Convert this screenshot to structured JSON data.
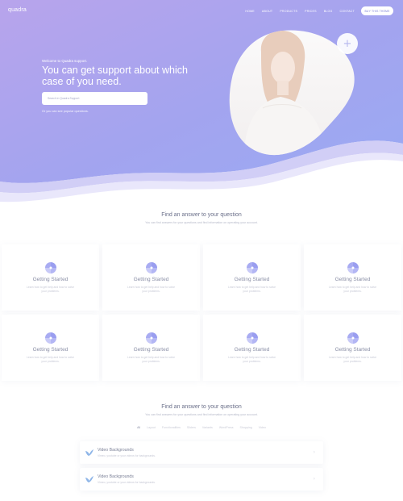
{
  "header": {
    "logo": "quadra",
    "nav": [
      "HOME",
      "ABOUT",
      "PRODUCTS",
      "PRICES",
      "BLOG",
      "CONTACT"
    ],
    "cta": "BUY THIS THEME"
  },
  "hero": {
    "welcome": "Welcome to Quadra support.",
    "title": "You can get support about which case of you need.",
    "search_placeholder": "Search in Quadra Support",
    "hint": "Or you can see popular questions.",
    "plus": "+"
  },
  "section1": {
    "title": "Find an answer to your question",
    "subtitle": "You can find answers for your questions and find information on operating your account."
  },
  "cards": [
    {
      "title": "Getting Started",
      "desc": "Learn how to get help and how to solve your problems."
    },
    {
      "title": "Getting Started",
      "desc": "Learn how to get help and how to solve your problems."
    },
    {
      "title": "Getting Started",
      "desc": "Learn how to get help and how to solve your problems."
    },
    {
      "title": "Getting Started",
      "desc": "Learn how to get help and how to solve your problems."
    },
    {
      "title": "Getting Started",
      "desc": "Learn how to get help and how to solve your problems."
    },
    {
      "title": "Getting Started",
      "desc": "Learn how to get help and how to solve your problems."
    },
    {
      "title": "Getting Started",
      "desc": "Learn how to get help and how to solve your problems."
    },
    {
      "title": "Getting Started",
      "desc": "Learn how to get help and how to solve your problems."
    }
  ],
  "section2": {
    "title": "Find an answer to your question",
    "subtitle": "You can find answers for your questions and find information on operating your account."
  },
  "filters": [
    "All",
    "Layout",
    "Functionalities",
    "Sliders",
    "Variants",
    "WordPress",
    "Shopping",
    "Video"
  ],
  "list": [
    {
      "title": "Video Backgrounds",
      "desc": "Vimeo, youtube or your videos for backgrounds."
    },
    {
      "title": "Video Backgrounds",
      "desc": "Vimeo, youtube or your videos for backgrounds."
    }
  ],
  "colors": {
    "hero_gradient_start": "#b6a5ee",
    "hero_gradient_end": "#9da8f2",
    "accent": "#9a9ef0",
    "list_icon": "#8fb6e8"
  }
}
